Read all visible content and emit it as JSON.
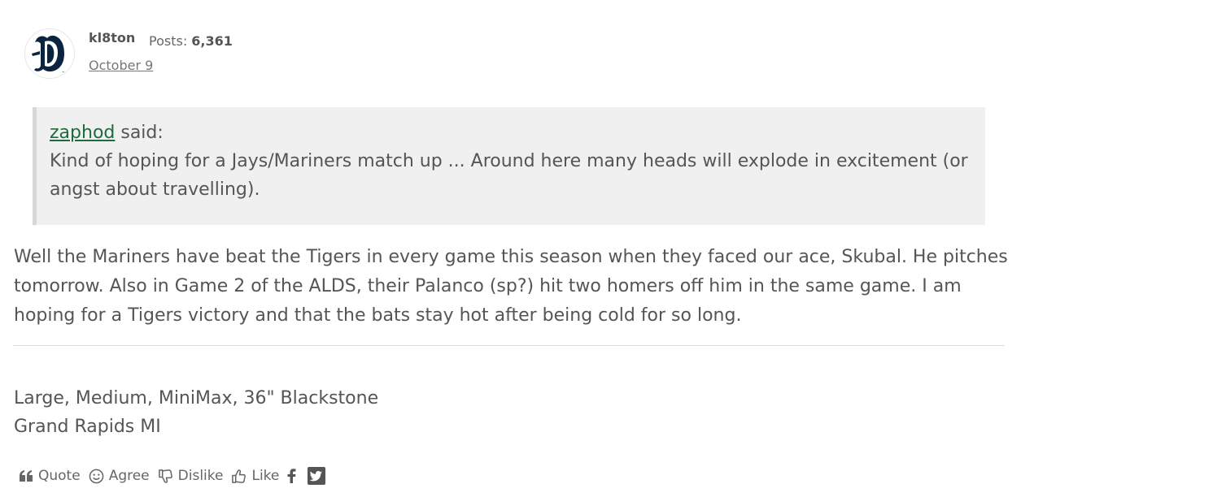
{
  "post": {
    "author": "kl8ton",
    "posts_label": "Posts:",
    "posts_count": "6,361",
    "date": "October 9",
    "avatar_icon": "old-english-d-logo-icon"
  },
  "quote": {
    "author": "zaphod",
    "said_label": " said:",
    "text": "Kind of hoping for a Jays/Mariners match up ...  Around here many heads will explode in excitement (or angst about travelling)."
  },
  "message": {
    "text": "Well the Mariners have beat the Tigers in every game this season when they faced our ace, Skubal.  He pitches tomorrow.  Also in Game 2 of the ALDS, their Palanco (sp?) hit two homers off him in the same game.  I am hoping for a Tigers victory and that the bats stay hot after being cold for so long."
  },
  "signature": {
    "line1": "Large, Medium, MiniMax, 36\" Blackstone",
    "line2": "Grand Rapids MI"
  },
  "actions": {
    "quote_label": "Quote",
    "agree_label": "Agree",
    "dislike_label": "Dislike",
    "like_label": "Like",
    "icons": [
      "quote-icon",
      "smiley-icon",
      "thumbs-down-icon",
      "thumbs-up-icon",
      "facebook-icon",
      "twitter-icon"
    ]
  },
  "colors": {
    "text": "#555555",
    "quote_background": "#f0f0f0",
    "link_green": "#1e6b3c",
    "logo_navy": "#0c2340"
  }
}
